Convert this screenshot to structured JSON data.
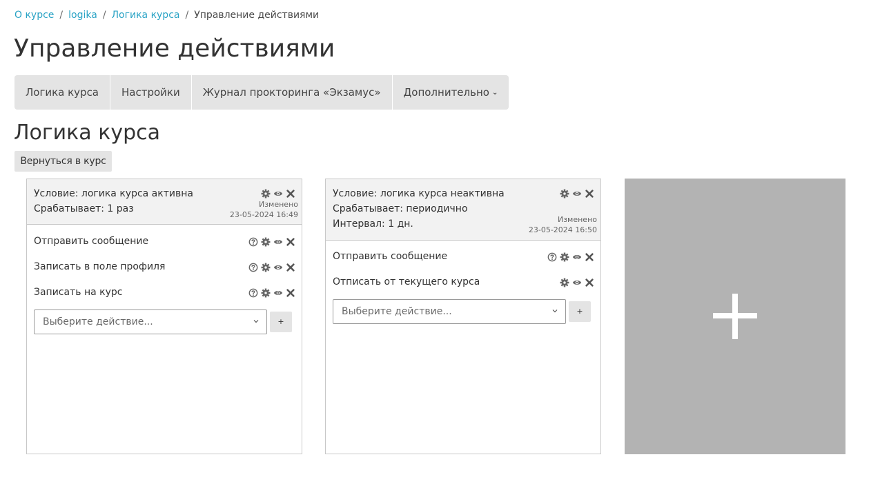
{
  "breadcrumb": {
    "items": [
      "О курсе",
      "logika",
      "Логика курса"
    ],
    "separator": "/",
    "current": "Управление действиями"
  },
  "page_title": "Управление действиями",
  "nav": {
    "items": [
      "Логика курса",
      "Настройки",
      "Журнал прокторинга «Экзамус»"
    ],
    "more": "Дополнительно"
  },
  "section_title": "Логика курса",
  "back_button": "Вернуться в курс",
  "rules": [
    {
      "condition": "Условие: логика курса активна",
      "trigger": "Срабатывает: 1 раз",
      "changed_label": "Изменено",
      "changed_date": "23-05-2024 16:49",
      "actions": [
        "Отправить сообщение",
        "Записать в поле профиля",
        "Записать на курс"
      ],
      "select_placeholder": "Выберите действие...",
      "add_label": "+"
    },
    {
      "condition": "Условие: логика курса неактивна",
      "trigger": "Срабатывает: периодично",
      "interval": "Интервал: 1 дн.",
      "changed_label": "Изменено",
      "changed_date": "23-05-2024 16:50",
      "actions": [
        "Отправить сообщение",
        "Отписать от текущего курса"
      ],
      "select_placeholder": "Выберите действие...",
      "add_label": "+"
    }
  ],
  "colors": {
    "link": "#2aa3c5",
    "nav_bg": "#e4e4e4",
    "card_head_bg": "#f2f2f2",
    "add_tile_bg": "#b3b3b3",
    "icon": "#666666"
  }
}
